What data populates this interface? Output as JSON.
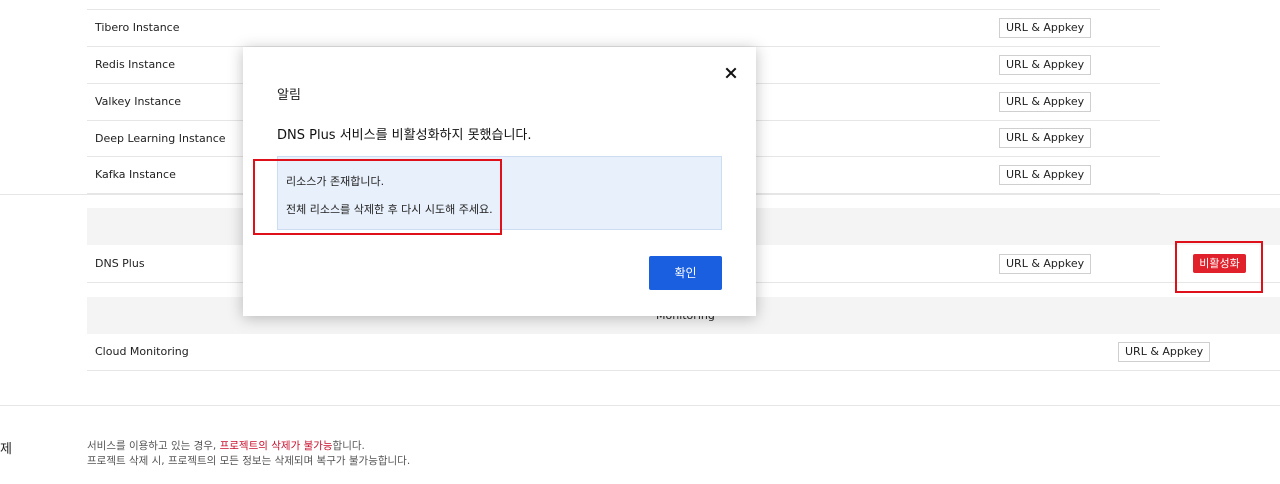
{
  "rows": [
    {
      "label": "Tibero Instance",
      "button": "URL & Appkey"
    },
    {
      "label": "Redis Instance",
      "button": "URL & Appkey"
    },
    {
      "label": "Valkey Instance",
      "button": "URL & Appkey"
    },
    {
      "label": "Deep Learning Instance",
      "button": "URL & Appkey"
    },
    {
      "label": "Kafka Instance",
      "button": "URL & Appkey"
    }
  ],
  "dns_row": {
    "label": "DNS Plus",
    "button": "URL & Appkey",
    "deactivate": "비활성화"
  },
  "monitoring_band": {
    "label": "Monitoring"
  },
  "cloud_row": {
    "label": "Cloud Monitoring",
    "button": "URL & Appkey"
  },
  "bottom": {
    "label": "제",
    "line1_pre": "서비스를 이용하고 있는 경우, ",
    "line1_hl": "프로젝트의 삭제가 불가능",
    "line1_post": "합니다.",
    "line2": "프로젝트 삭제 시, 프로젝트의 모든 정보는 삭제되며 복구가 불가능합니다."
  },
  "modal": {
    "title": "알림",
    "message": "DNS Plus 서비스를 비활성화하지 못했습니다.",
    "info_line1": "리소스가 존재합니다.",
    "info_line2": "전체 리소스를 삭제한 후 다시 시도해 주세요.",
    "ok": "확인"
  },
  "colors": {
    "primary": "#1a5fe0",
    "danger": "#e0202a",
    "highlight": "#e0101a"
  }
}
